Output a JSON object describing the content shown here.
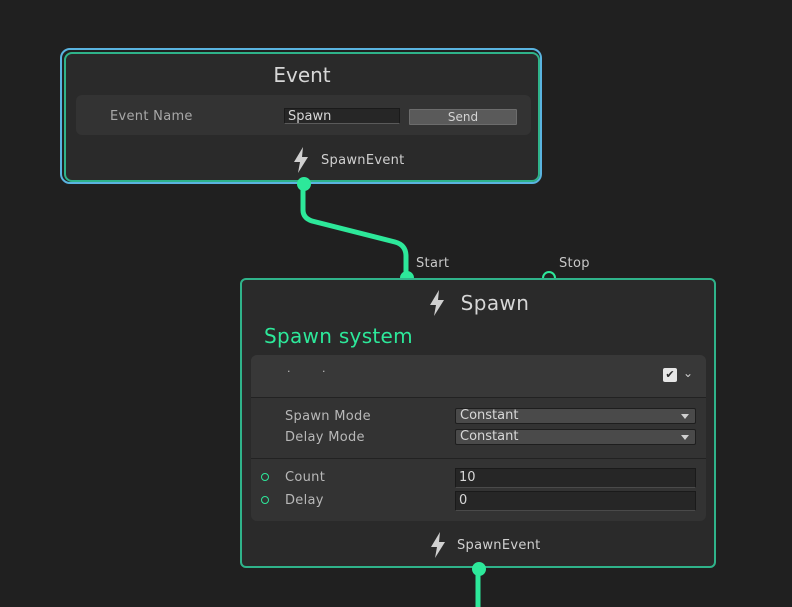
{
  "event_node": {
    "title": "Event",
    "field_label": "Event Name",
    "field_value": "Spawn",
    "send_label": "Send",
    "output_icon": "lightning-bolt-icon",
    "output_label": "SpawnEvent"
  },
  "spawn_node": {
    "input_ports": [
      {
        "label": "Start",
        "connected": true
      },
      {
        "label": "Stop",
        "connected": false
      }
    ],
    "title_icon": "lightning-bolt-icon",
    "title": "Spawn",
    "subtitle": "Spawn system",
    "block": {
      "enabled": true,
      "settings": [
        {
          "label": "Spawn Mode",
          "value": "Constant"
        },
        {
          "label": "Delay Mode",
          "value": "Constant"
        }
      ],
      "properties": [
        {
          "label": "Count",
          "value": "10"
        },
        {
          "label": "Delay",
          "value": "0"
        }
      ]
    },
    "output_icon": "lightning-bolt-icon",
    "output_label": "SpawnEvent"
  },
  "colors": {
    "background": "#202020",
    "node_bg": "#2a2a2a",
    "accent_green": "#2de89a",
    "node_border": "#2fb38a",
    "selection_blue": "#5ab4e0"
  }
}
